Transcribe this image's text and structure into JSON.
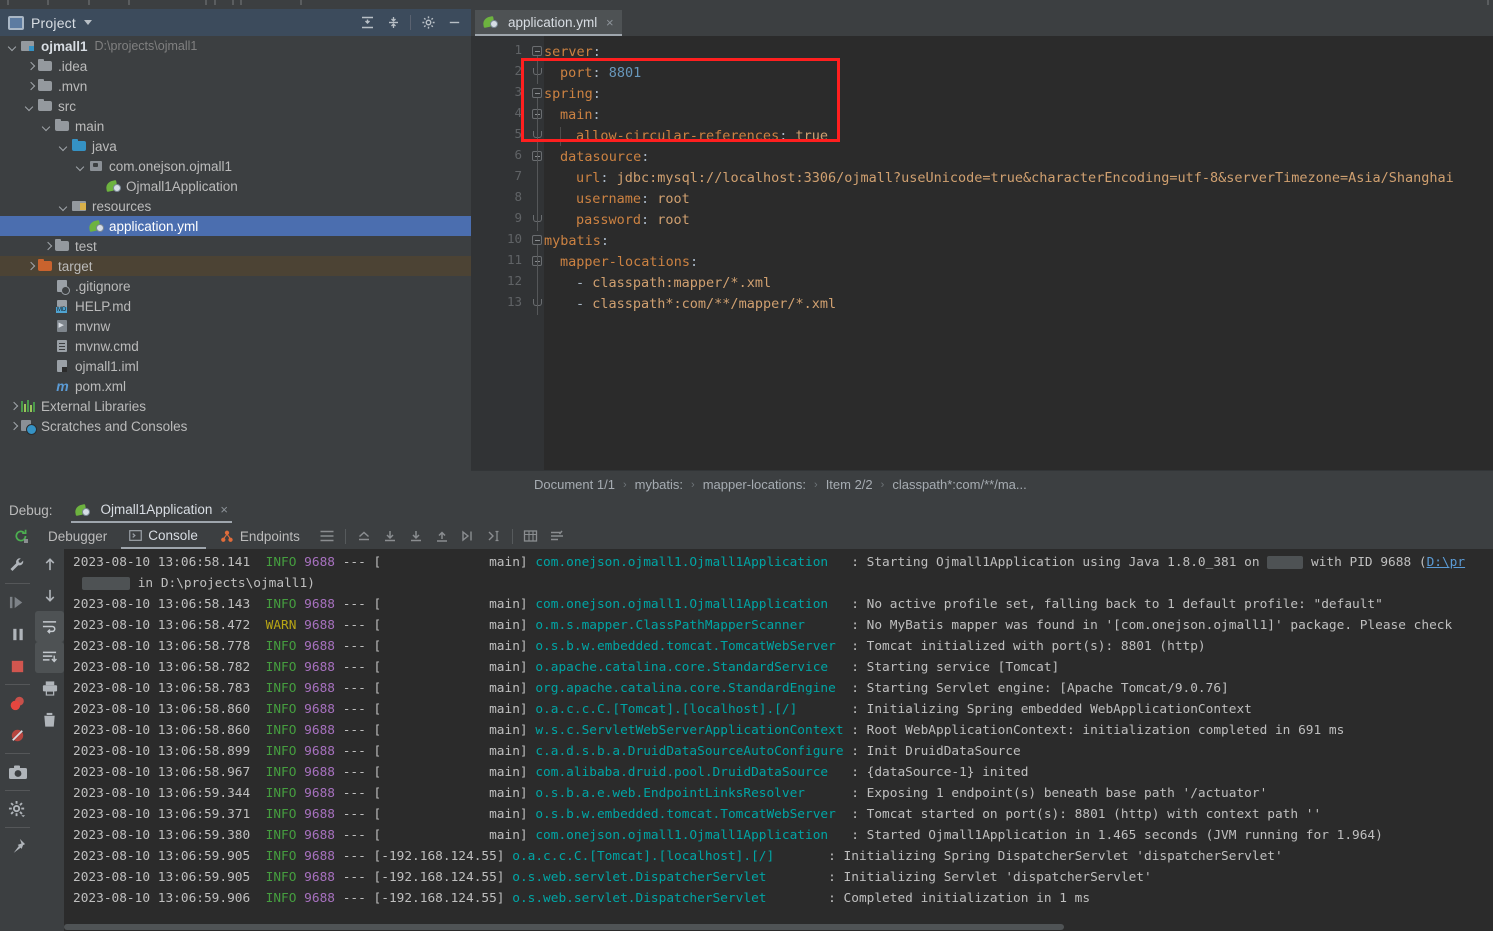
{
  "project_panel": {
    "title": "Project",
    "tools": [
      "expand-all-icon",
      "collapse-all-icon",
      "gear-icon",
      "minimize-icon"
    ],
    "tree": [
      {
        "label": "ojmall1",
        "path": "D:\\projects\\ojmall1",
        "icon": "module-icon",
        "arrow": "down",
        "indent": 0,
        "bold": true,
        "state": "normal"
      },
      {
        "label": ".idea",
        "path": "",
        "icon": "folder-icon",
        "arrow": "right",
        "indent": 1,
        "bold": false,
        "state": "normal"
      },
      {
        "label": ".mvn",
        "path": "",
        "icon": "folder-icon",
        "arrow": "right",
        "indent": 1,
        "bold": false,
        "state": "normal"
      },
      {
        "label": "src",
        "path": "",
        "icon": "folder-icon",
        "arrow": "down",
        "indent": 1,
        "bold": false,
        "state": "normal"
      },
      {
        "label": "main",
        "path": "",
        "icon": "folder-icon",
        "arrow": "down",
        "indent": 2,
        "bold": false,
        "state": "normal"
      },
      {
        "label": "java",
        "path": "",
        "icon": "source-folder-icon",
        "arrow": "down",
        "indent": 3,
        "bold": false,
        "state": "normal"
      },
      {
        "label": "com.onejson.ojmall1",
        "path": "",
        "icon": "package-icon",
        "arrow": "down",
        "indent": 4,
        "bold": false,
        "state": "normal"
      },
      {
        "label": "Ojmall1Application",
        "path": "",
        "icon": "spring-class-icon",
        "arrow": "none",
        "indent": 5,
        "bold": false,
        "state": "normal"
      },
      {
        "label": "resources",
        "path": "",
        "icon": "resources-folder-icon",
        "arrow": "down",
        "indent": 3,
        "bold": false,
        "state": "normal"
      },
      {
        "label": "application.yml",
        "path": "",
        "icon": "spring-yaml-icon",
        "arrow": "none",
        "indent": 4,
        "bold": false,
        "state": "selected"
      },
      {
        "label": "test",
        "path": "",
        "icon": "folder-icon",
        "arrow": "right",
        "indent": 2,
        "bold": false,
        "state": "normal"
      },
      {
        "label": "target",
        "path": "",
        "icon": "excluded-folder-icon",
        "arrow": "right",
        "indent": 1,
        "bold": false,
        "state": "highlighted"
      },
      {
        "label": ".gitignore",
        "path": "",
        "icon": "gitignore-file-icon",
        "arrow": "none",
        "indent": 2,
        "bold": false,
        "state": "normal"
      },
      {
        "label": "HELP.md",
        "path": "",
        "icon": "markdown-file-icon",
        "arrow": "none",
        "indent": 2,
        "bold": false,
        "state": "normal"
      },
      {
        "label": "mvnw",
        "path": "",
        "icon": "shell-file-icon",
        "arrow": "none",
        "indent": 2,
        "bold": false,
        "state": "normal"
      },
      {
        "label": "mvnw.cmd",
        "path": "",
        "icon": "cmd-file-icon",
        "arrow": "none",
        "indent": 2,
        "bold": false,
        "state": "normal"
      },
      {
        "label": "ojmall1.iml",
        "path": "",
        "icon": "iml-file-icon",
        "arrow": "none",
        "indent": 2,
        "bold": false,
        "state": "normal"
      },
      {
        "label": "pom.xml",
        "path": "",
        "icon": "maven-file-icon",
        "arrow": "none",
        "indent": 2,
        "bold": false,
        "state": "normal"
      },
      {
        "label": "External Libraries",
        "path": "",
        "icon": "libraries-icon",
        "arrow": "right",
        "indent": 0,
        "bold": false,
        "state": "normal"
      },
      {
        "label": "Scratches and Consoles",
        "path": "",
        "icon": "scratches-icon",
        "arrow": "right",
        "indent": 0,
        "bold": false,
        "state": "normal"
      }
    ]
  },
  "editor": {
    "tab": {
      "label": "application.yml",
      "icon": "spring-yaml-icon",
      "close": "×"
    },
    "line_numbers": [
      "1",
      "2",
      "3",
      "4",
      "5",
      "6",
      "7",
      "8",
      "9",
      "10",
      "11",
      "12",
      "13"
    ],
    "lines": [
      {
        "num": 1,
        "indent": 0,
        "segments": [
          {
            "t": "server",
            "c": "k"
          },
          {
            "t": ":",
            "c": "p"
          }
        ]
      },
      {
        "num": 2,
        "indent": 1,
        "segments": [
          {
            "t": "port",
            "c": "k"
          },
          {
            "t": ": ",
            "c": "p"
          },
          {
            "t": "8801",
            "c": "n"
          }
        ]
      },
      {
        "num": 3,
        "indent": 0,
        "segments": [
          {
            "t": "spring",
            "c": "k"
          },
          {
            "t": ":",
            "c": "p"
          }
        ]
      },
      {
        "num": 4,
        "indent": 1,
        "segments": [
          {
            "t": "main",
            "c": "k"
          },
          {
            "t": ":",
            "c": "p"
          }
        ]
      },
      {
        "num": 5,
        "indent": 2,
        "segments": [
          {
            "t": "allow-circular-references",
            "c": "k"
          },
          {
            "t": ": ",
            "c": "p"
          },
          {
            "t": "true",
            "c": "v"
          }
        ]
      },
      {
        "num": 6,
        "indent": 1,
        "segments": [
          {
            "t": "datasource",
            "c": "k"
          },
          {
            "t": ":",
            "c": "p"
          }
        ]
      },
      {
        "num": 7,
        "indent": 2,
        "segments": [
          {
            "t": "url",
            "c": "k"
          },
          {
            "t": ": ",
            "c": "p"
          },
          {
            "t": "jdbc:mysql://localhost:3306/ojmall?useUnicode=true&characterEncoding=utf-8&serverTimezone=Asia/Shanghai",
            "c": "v"
          }
        ]
      },
      {
        "num": 8,
        "indent": 2,
        "segments": [
          {
            "t": "username",
            "c": "k"
          },
          {
            "t": ": ",
            "c": "p"
          },
          {
            "t": "root",
            "c": "v"
          }
        ]
      },
      {
        "num": 9,
        "indent": 2,
        "segments": [
          {
            "t": "password",
            "c": "k"
          },
          {
            "t": ": ",
            "c": "p"
          },
          {
            "t": "root",
            "c": "v"
          }
        ]
      },
      {
        "num": 10,
        "indent": 0,
        "segments": [
          {
            "t": "mybatis",
            "c": "k"
          },
          {
            "t": ":",
            "c": "p"
          }
        ]
      },
      {
        "num": 11,
        "indent": 1,
        "segments": [
          {
            "t": "mapper-locations",
            "c": "k"
          },
          {
            "t": ":",
            "c": "p"
          }
        ]
      },
      {
        "num": 12,
        "indent": 2,
        "segments": [
          {
            "t": "- ",
            "c": "p"
          },
          {
            "t": "classpath:mapper/*.xml",
            "c": "v"
          }
        ]
      },
      {
        "num": 13,
        "indent": 2,
        "segments": [
          {
            "t": "- ",
            "c": "p"
          },
          {
            "t": "classpath*:com/**/mapper/*.xml",
            "c": "v"
          }
        ]
      }
    ],
    "annotation": {
      "color": "#ff1f1f",
      "label": "red-highlight-box"
    },
    "breadcrumb": [
      "Document 1/1",
      "mybatis:",
      "mapper-locations:",
      "Item 2/2",
      "classpath*:com/**/ma..."
    ]
  },
  "debug": {
    "label": "Debug:",
    "run_config": "Ojmall1Application",
    "close": "×",
    "tabs": [
      {
        "label": "Debugger",
        "icon": "",
        "active": false
      },
      {
        "label": "Console",
        "icon": "console-icon",
        "active": true
      },
      {
        "label": "Endpoints",
        "icon": "endpoints-icon",
        "active": false
      }
    ],
    "toolbar_icons": [
      "rerun-icon",
      "layout-icon",
      "soft-wrap-icon",
      "scroll-to-end-icon",
      "scroll-to-top-icon",
      "up-icon",
      "down-icon",
      "print-icon",
      "clear-icon"
    ],
    "left_icons": [
      "wrench-icon",
      "resume-icon",
      "pause-icon",
      "stop-icon",
      "view-breakpoints-icon",
      "mute-breakpoints-icon",
      "camera-icon",
      "settings-icon",
      "pin-icon"
    ],
    "left_icons2": [
      "step-up-icon",
      "step-down-icon",
      "soft-wrap-toggle-icon",
      "scroll-end-toggle-icon",
      "print-icon",
      "trash-icon"
    ]
  },
  "console": {
    "lines": [
      {
        "ts": "2023-08-10 13:06:58.141",
        "level": "INFO",
        "pid": "9688",
        "thread": "main",
        "logger": "com.onejson.ojmall1.Ojmall1Application",
        "msg": " : Starting Ojmall1Application using Java 1.8.0_381 on ",
        "msg2": " with PID 9688 (",
        "link": "D:\\pr"
      },
      {
        "ts": "",
        "level": "",
        "pid": "",
        "thread": "",
        "logger": "",
        "msg": "in D:\\projects\\ojmall1)",
        "continuation": true
      },
      {
        "ts": "2023-08-10 13:06:58.143",
        "level": "INFO",
        "pid": "9688",
        "thread": "main",
        "logger": "com.onejson.ojmall1.Ojmall1Application",
        "msg": " : No active profile set, falling back to 1 default profile: \"default\""
      },
      {
        "ts": "2023-08-10 13:06:58.472",
        "level": "WARN",
        "pid": "9688",
        "thread": "main",
        "logger": "o.m.s.mapper.ClassPathMapperScanner",
        "msg": " : No MyBatis mapper was found in '[com.onejson.ojmall1]' package. Please check  "
      },
      {
        "ts": "2023-08-10 13:06:58.778",
        "level": "INFO",
        "pid": "9688",
        "thread": "main",
        "logger": "o.s.b.w.embedded.tomcat.TomcatWebServer",
        "msg": " : Tomcat initialized with port(s): 8801 (http)"
      },
      {
        "ts": "2023-08-10 13:06:58.782",
        "level": "INFO",
        "pid": "9688",
        "thread": "main",
        "logger": "o.apache.catalina.core.StandardService",
        "msg": " : Starting service [Tomcat]"
      },
      {
        "ts": "2023-08-10 13:06:58.783",
        "level": "INFO",
        "pid": "9688",
        "thread": "main",
        "logger": "org.apache.catalina.core.StandardEngine",
        "msg": " : Starting Servlet engine: [Apache Tomcat/9.0.76]"
      },
      {
        "ts": "2023-08-10 13:06:58.860",
        "level": "INFO",
        "pid": "9688",
        "thread": "main",
        "logger": "o.a.c.c.C.[Tomcat].[localhost].[/]",
        "msg": " : Initializing Spring embedded WebApplicationContext"
      },
      {
        "ts": "2023-08-10 13:06:58.860",
        "level": "INFO",
        "pid": "9688",
        "thread": "main",
        "logger": "w.s.c.ServletWebServerApplicationContext",
        "msg": " : Root WebApplicationContext: initialization completed in 691 ms"
      },
      {
        "ts": "2023-08-10 13:06:58.899",
        "level": "INFO",
        "pid": "9688",
        "thread": "main",
        "logger": "c.a.d.s.b.a.DruidDataSourceAutoConfigure",
        "msg": " : Init DruidDataSource"
      },
      {
        "ts": "2023-08-10 13:06:58.967",
        "level": "INFO",
        "pid": "9688",
        "thread": "main",
        "logger": "com.alibaba.druid.pool.DruidDataSource",
        "msg": " : {dataSource-1} inited"
      },
      {
        "ts": "2023-08-10 13:06:59.344",
        "level": "INFO",
        "pid": "9688",
        "thread": "main",
        "logger": "o.s.b.a.e.web.EndpointLinksResolver",
        "msg": " : Exposing 1 endpoint(s) beneath base path '/actuator'"
      },
      {
        "ts": "2023-08-10 13:06:59.371",
        "level": "INFO",
        "pid": "9688",
        "thread": "main",
        "logger": "o.s.b.w.embedded.tomcat.TomcatWebServer",
        "msg": " : Tomcat started on port(s): 8801 (http) with context path ''"
      },
      {
        "ts": "2023-08-10 13:06:59.380",
        "level": "INFO",
        "pid": "9688",
        "thread": "main",
        "logger": "com.onejson.ojmall1.Ojmall1Application",
        "msg": " : Started Ojmall1Application in 1.465 seconds (JVM running for 1.964)"
      },
      {
        "ts": "2023-08-10 13:06:59.905",
        "level": "INFO",
        "pid": "9688",
        "thread": "-192.168.124.55",
        "logger": "o.a.c.c.C.[Tomcat].[localhost].[/]",
        "msg": " : Initializing Spring DispatcherServlet 'dispatcherServlet'"
      },
      {
        "ts": "2023-08-10 13:06:59.905",
        "level": "INFO",
        "pid": "9688",
        "thread": "-192.168.124.55",
        "logger": "o.s.web.servlet.DispatcherServlet",
        "msg": " : Initializing Servlet 'dispatcherServlet'"
      },
      {
        "ts": "2023-08-10 13:06:59.906",
        "level": "INFO",
        "pid": "9688",
        "thread": "-192.168.124.55",
        "logger": "o.s.web.servlet.DispatcherServlet",
        "msg": " : Completed initialization in 1 ms"
      }
    ]
  },
  "colors": {
    "panel_bg": "#3c3f41",
    "editor_bg": "#2b2b2b",
    "selection": "#4b6eaf",
    "highlight_row": "#4c4334",
    "annotation_red": "#ff1f1f",
    "info_green": "#459e3f",
    "warn_yellow": "#b8a615",
    "logger_teal": "#00a5a5",
    "key_orange": "#cc8242"
  }
}
